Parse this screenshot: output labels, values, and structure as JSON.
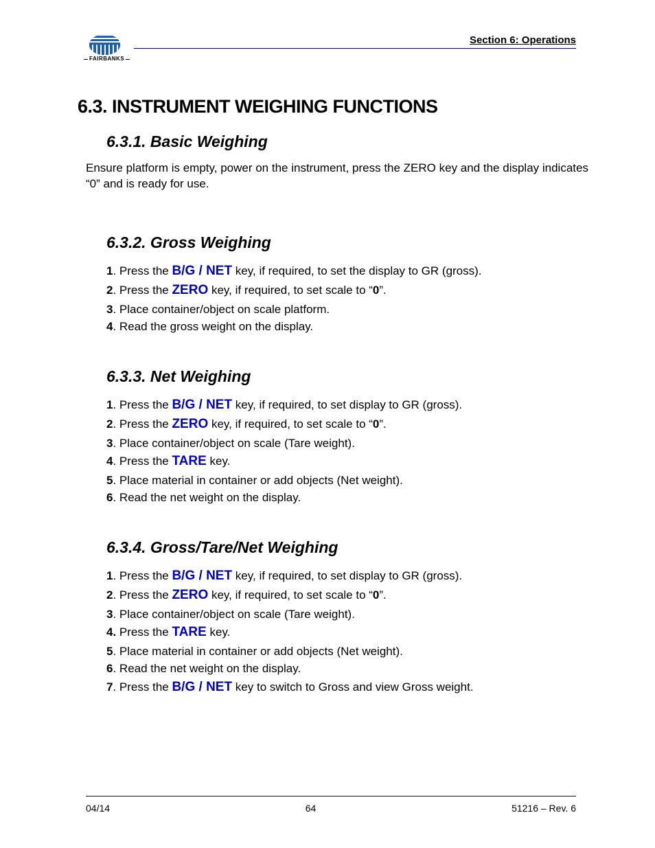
{
  "header": {
    "sectionLabel": "Section 6: Operations",
    "logoText": "FAIRBANKS"
  },
  "h1": "6.3.  INSTRUMENT WEIGHING FUNCTIONS",
  "s1": {
    "title": "6.3.1.  Basic Weighing",
    "para": "Ensure platform is empty, power on the instrument, press the ZERO key and the display indicates “0” and is ready for use."
  },
  "s2": {
    "title": "6.3.2.  Gross Weighing",
    "items": {
      "n1": "1",
      "t1a": ". Press the ",
      "k1": "B/G / NET",
      "t1b": " key, if required, to set the display to GR (gross).",
      "n2": "2",
      "t2a": ". Press the ",
      "k2": "ZERO",
      "t2b": " key, if required, to set scale to “",
      "b2": "0",
      "t2c": "”.",
      "n3": "3",
      "t3": ". Place container/object on scale platform.",
      "n4": "4",
      "t4": ". Read the gross weight on the display."
    }
  },
  "s3": {
    "title": "6.3.3.  Net Weighing",
    "items": {
      "n1": "1",
      "t1a": ". Press the ",
      "k1": "B/G / NET",
      "t1b": " key, if required, to set display to GR (gross).",
      "n2": "2",
      "t2a": ". Press the ",
      "k2": "ZERO",
      "t2b": " key, if required, to set scale to “",
      "b2": "0",
      "t2c": "”.",
      "n3": "3",
      "t3": ". Place container/object on scale (Tare weight).",
      "n4": "4",
      "t4a": ". Press the ",
      "k4": "TARE",
      "t4b": " key.",
      "n5": "5",
      "t5": ". Place material in container or add objects (Net weight).",
      "n6": "6",
      "t6": ". Read the net weight on the display."
    }
  },
  "s4": {
    "title": "6.3.4.  Gross/Tare/Net Weighing",
    "items": {
      "n1": "1",
      "t1a": ". Press the ",
      "k1": "B/G / NET",
      "t1b": " key, if required, to set display to GR (gross).",
      "n2": "2",
      "t2a": ". Press the ",
      "k2": "ZERO",
      "t2b": " key, if required, to set scale to “",
      "b2": "0",
      "t2c": "”.",
      "n3": "3",
      "t3": ". Place container/object on scale (Tare weight).",
      "n4": "4.",
      "t4a": " Press the ",
      "k4": "TARE",
      "t4b": " key.",
      "n5": "5",
      "t5": ". Place material in container or add objects (Net weight).",
      "n6": "6",
      "t6": ". Read the net weight on the display.",
      "n7": "7",
      "t7a": ". Press the ",
      "k7": "B/G / NET",
      "t7b": " key to switch to Gross and view Gross weight."
    }
  },
  "footer": {
    "left": "04/14",
    "center": "64",
    "right": "51216 – Rev. 6"
  }
}
